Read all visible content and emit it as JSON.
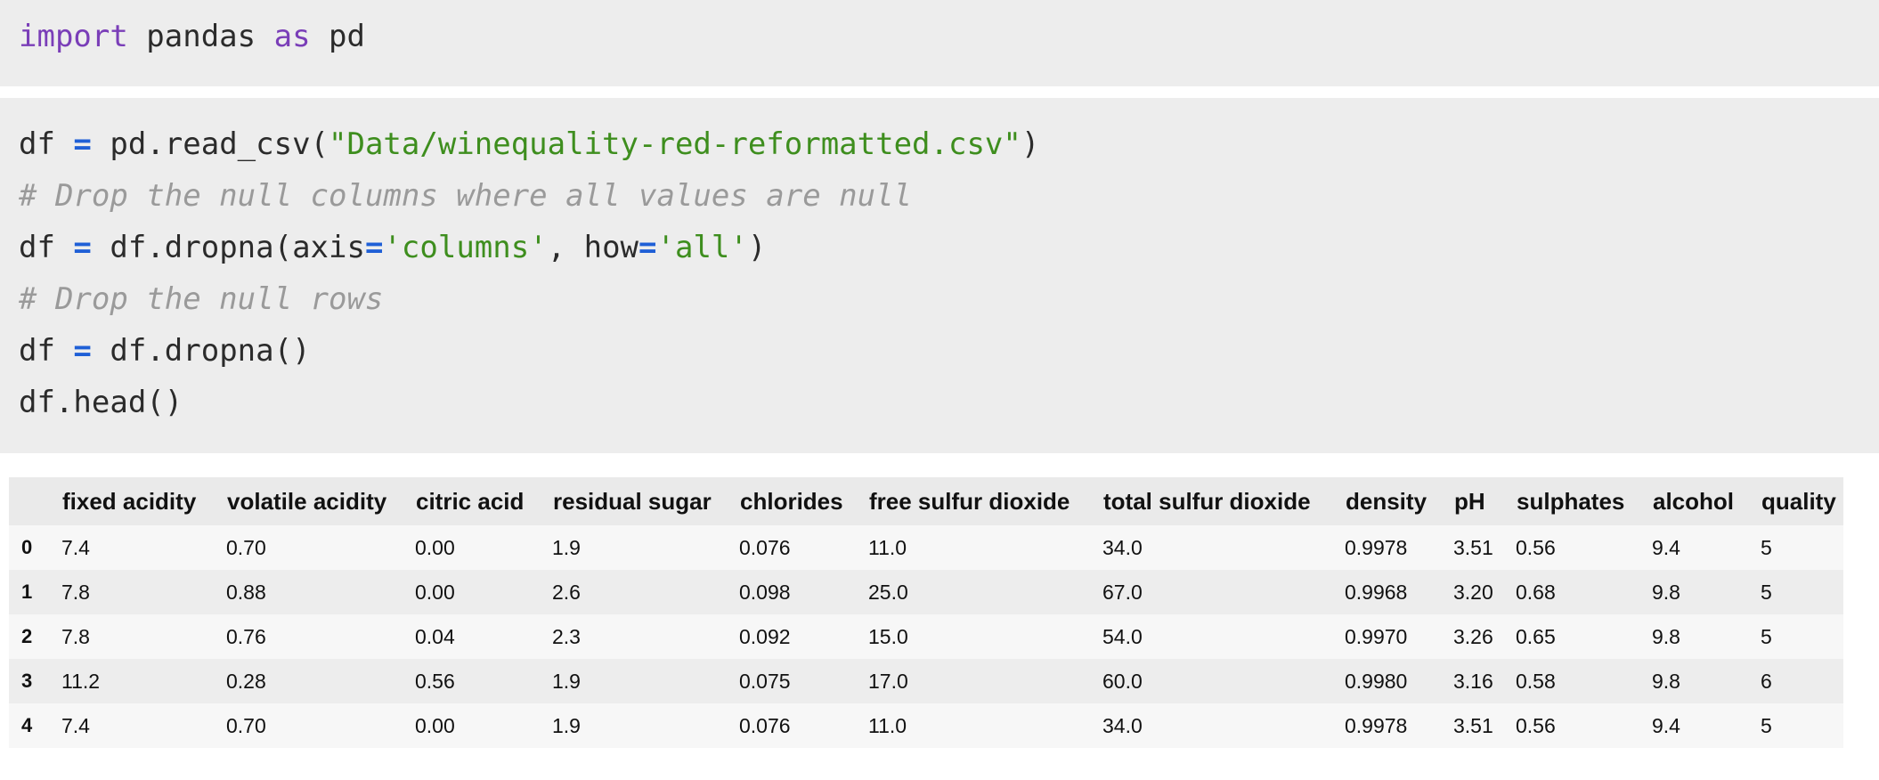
{
  "cells": {
    "cell1": {
      "lines": [
        [
          {
            "t": "import",
            "c": "kw"
          },
          {
            "t": " pandas ",
            "c": ""
          },
          {
            "t": "as",
            "c": "kw"
          },
          {
            "t": " pd",
            "c": ""
          }
        ]
      ]
    },
    "cell2": {
      "lines": [
        [
          {
            "t": "df ",
            "c": ""
          },
          {
            "t": "=",
            "c": "op"
          },
          {
            "t": " pd.read_csv(",
            "c": ""
          },
          {
            "t": "\"Data/winequality-red-reformatted.csv\"",
            "c": "str"
          },
          {
            "t": ")",
            "c": ""
          }
        ],
        [
          {
            "t": "# Drop the null columns where all values are null",
            "c": "cmt"
          }
        ],
        [
          {
            "t": "df ",
            "c": ""
          },
          {
            "t": "=",
            "c": "op"
          },
          {
            "t": " df.dropna(axis",
            "c": ""
          },
          {
            "t": "=",
            "c": "op"
          },
          {
            "t": "'columns'",
            "c": "str"
          },
          {
            "t": ", how",
            "c": ""
          },
          {
            "t": "=",
            "c": "op"
          },
          {
            "t": "'all'",
            "c": "str"
          },
          {
            "t": ")",
            "c": ""
          }
        ],
        [
          {
            "t": "# Drop the null rows",
            "c": "cmt"
          }
        ],
        [
          {
            "t": "df ",
            "c": ""
          },
          {
            "t": "=",
            "c": "op"
          },
          {
            "t": " df.dropna()",
            "c": ""
          }
        ],
        [
          {
            "t": "df.head()",
            "c": ""
          }
        ]
      ]
    }
  },
  "table": {
    "columns": [
      "fixed acidity",
      "volatile acidity",
      "citric acid",
      "residual sugar",
      "chlorides",
      "free sulfur dioxide",
      "total sulfur dioxide",
      "density",
      "pH",
      "sulphates",
      "alcohol",
      "quality"
    ],
    "rows": [
      {
        "index": "0",
        "values": [
          "7.4",
          "0.70",
          "0.00",
          "1.9",
          "0.076",
          "11.0",
          "34.0",
          "0.9978",
          "3.51",
          "0.56",
          "9.4",
          "5"
        ]
      },
      {
        "index": "1",
        "values": [
          "7.8",
          "0.88",
          "0.00",
          "2.6",
          "0.098",
          "25.0",
          "67.0",
          "0.9968",
          "3.20",
          "0.68",
          "9.8",
          "5"
        ]
      },
      {
        "index": "2",
        "values": [
          "7.8",
          "0.76",
          "0.04",
          "2.3",
          "0.092",
          "15.0",
          "54.0",
          "0.9970",
          "3.26",
          "0.65",
          "9.8",
          "5"
        ]
      },
      {
        "index": "3",
        "values": [
          "11.2",
          "0.28",
          "0.56",
          "1.9",
          "0.075",
          "17.0",
          "60.0",
          "0.9980",
          "3.16",
          "0.58",
          "9.8",
          "6"
        ]
      },
      {
        "index": "4",
        "values": [
          "7.4",
          "0.70",
          "0.00",
          "1.9",
          "0.076",
          "11.0",
          "34.0",
          "0.9978",
          "3.51",
          "0.56",
          "9.4",
          "5"
        ]
      }
    ]
  }
}
